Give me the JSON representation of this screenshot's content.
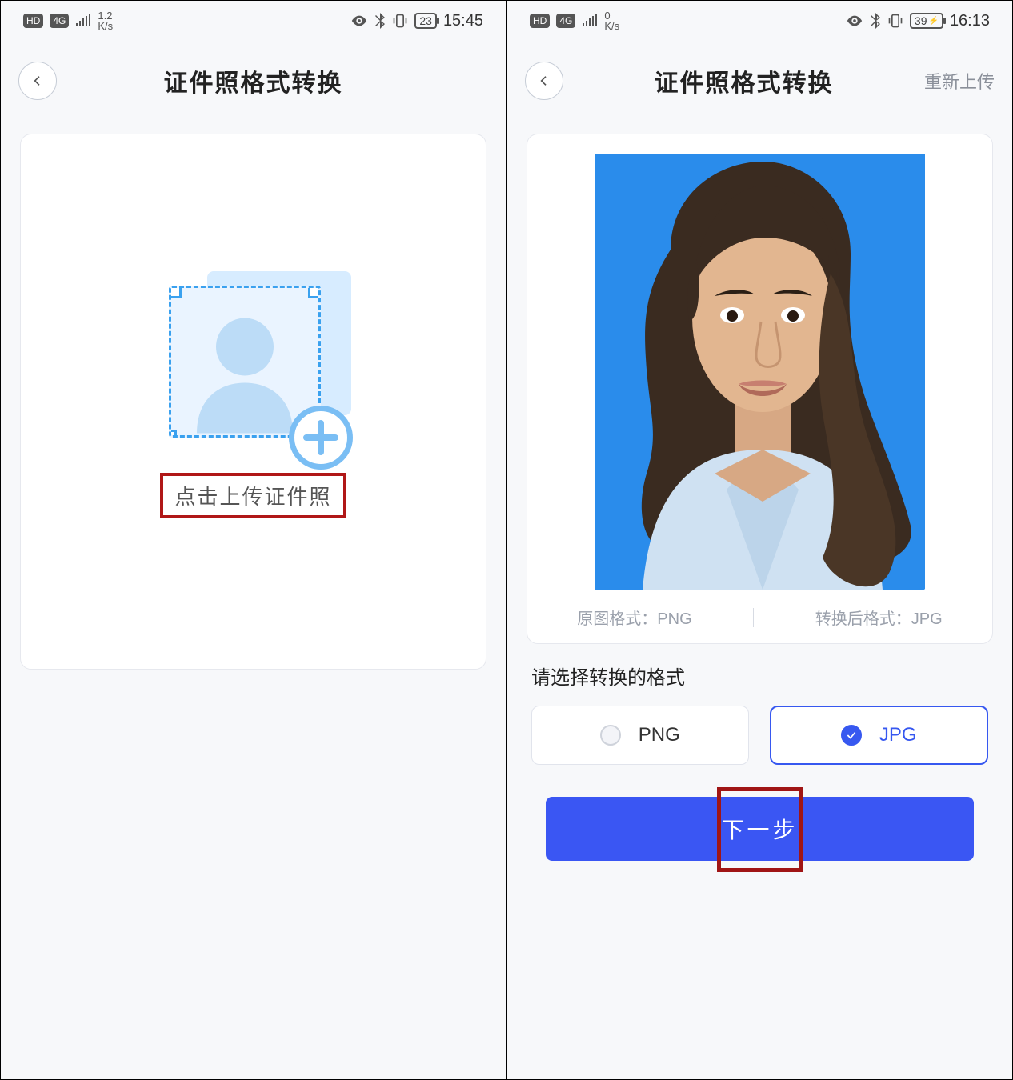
{
  "left": {
    "status": {
      "hd": "HD",
      "net": "4G",
      "speed_value": "1.2",
      "speed_unit": "K/s",
      "battery": "23",
      "time": "15:45"
    },
    "header": {
      "title": "证件照格式转换"
    },
    "upload": {
      "label": "点击上传证件照"
    }
  },
  "right": {
    "status": {
      "hd": "HD",
      "net": "4G",
      "speed_value": "0",
      "speed_unit": "K/s",
      "battery": "39",
      "time": "16:13"
    },
    "header": {
      "title": "证件照格式转换",
      "reupload": "重新上传"
    },
    "formats": {
      "src_label": "原图格式：",
      "src_value": "PNG",
      "dst_label": "转换后格式：",
      "dst_value": "JPG"
    },
    "selector": {
      "title": "请选择转换的格式",
      "options": {
        "png": "PNG",
        "jpg": "JPG"
      }
    },
    "next": "下一步"
  }
}
